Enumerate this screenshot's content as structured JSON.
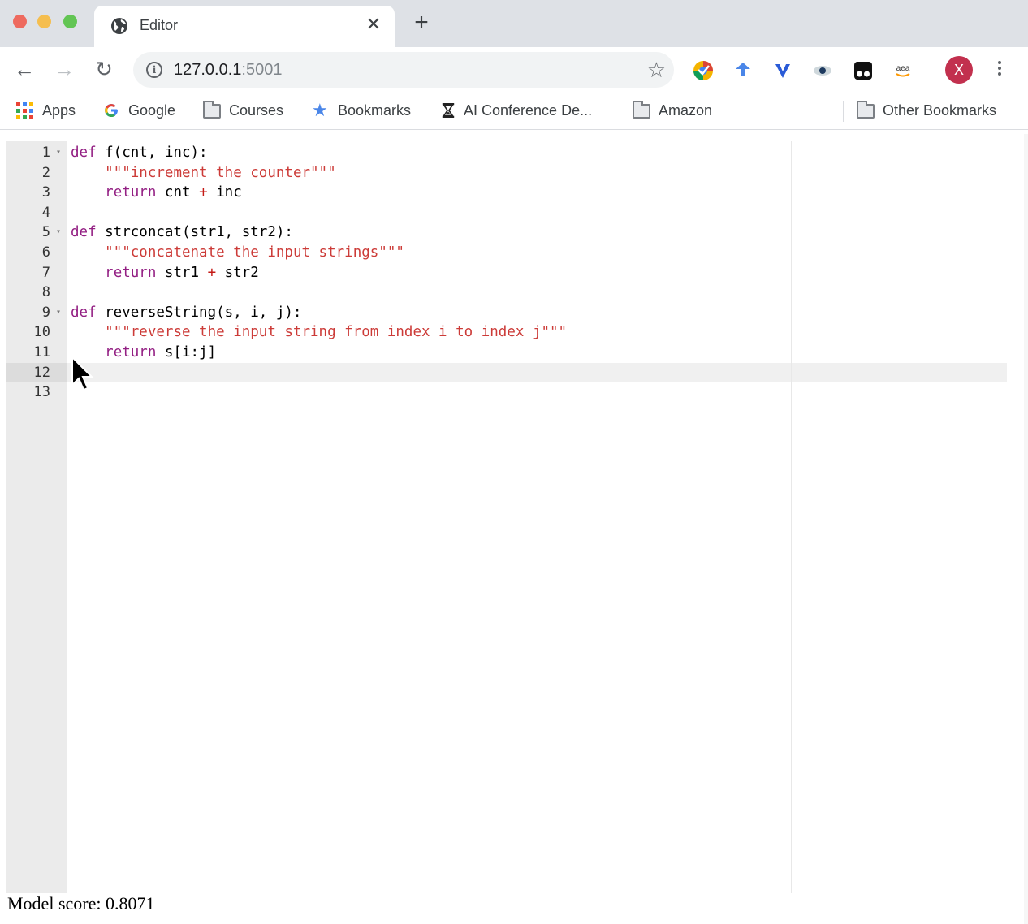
{
  "browser": {
    "tab": {
      "title": "Editor",
      "favicon": "globe-icon",
      "close_glyph": "✕"
    },
    "new_tab_glyph": "+",
    "nav": {
      "back_glyph": "←",
      "forward_glyph": "→",
      "reload_glyph": "↻"
    },
    "address": {
      "host": "127.0.0.1",
      "port": ":5001",
      "info_glyph": "i",
      "star_glyph": "☆"
    },
    "extensions": [
      "chrome-extension-color-icon",
      "extension-blue-arrow-icon",
      "extension-v-icon",
      "extension-eye-icon",
      "extension-glasses-icon",
      "extension-amazon-icon"
    ],
    "profile": {
      "initial": "X",
      "color": "#c2304e"
    },
    "bookmarks": [
      {
        "label": "Apps",
        "icon": "apps-grid-icon"
      },
      {
        "label": "Google",
        "icon": "google-icon"
      },
      {
        "label": "Courses",
        "icon": "folder-icon"
      },
      {
        "label": "Bookmarks",
        "icon": "star-icon"
      },
      {
        "label": "AI Conference De...",
        "icon": "hourglass-icon"
      },
      {
        "label": "Amazon",
        "icon": "folder-icon"
      }
    ],
    "other_bookmarks": {
      "label": "Other Bookmarks",
      "icon": "folder-icon"
    }
  },
  "editor": {
    "language": "python",
    "active_line": 12,
    "lines": [
      {
        "n": "1",
        "fold": true,
        "parts": [
          [
            "kw",
            "def"
          ],
          [
            "t",
            " f(cnt, inc):"
          ]
        ]
      },
      {
        "n": "2",
        "fold": false,
        "parts": [
          [
            "t",
            "    "
          ],
          [
            "str",
            "\"\"\"increment the counter\"\"\""
          ]
        ]
      },
      {
        "n": "3",
        "fold": false,
        "parts": [
          [
            "t",
            "    "
          ],
          [
            "ret",
            "return"
          ],
          [
            "t",
            " cnt "
          ],
          [
            "op",
            "+"
          ],
          [
            "t",
            " inc"
          ]
        ]
      },
      {
        "n": "4",
        "fold": false,
        "parts": []
      },
      {
        "n": "5",
        "fold": true,
        "parts": [
          [
            "kw",
            "def"
          ],
          [
            "t",
            " strconcat(str1, str2):"
          ]
        ]
      },
      {
        "n": "6",
        "fold": false,
        "parts": [
          [
            "t",
            "    "
          ],
          [
            "str",
            "\"\"\"concatenate the input strings\"\"\""
          ]
        ]
      },
      {
        "n": "7",
        "fold": false,
        "parts": [
          [
            "t",
            "    "
          ],
          [
            "ret",
            "return"
          ],
          [
            "t",
            " str1 "
          ],
          [
            "op",
            "+"
          ],
          [
            "t",
            " str2"
          ]
        ]
      },
      {
        "n": "8",
        "fold": false,
        "parts": []
      },
      {
        "n": "9",
        "fold": true,
        "parts": [
          [
            "kw",
            "def"
          ],
          [
            "t",
            " reverseString(s, i, j):"
          ]
        ]
      },
      {
        "n": "10",
        "fold": false,
        "parts": [
          [
            "t",
            "    "
          ],
          [
            "str",
            "\"\"\"reverse the input string from index i to index j\"\"\""
          ]
        ]
      },
      {
        "n": "11",
        "fold": false,
        "parts": [
          [
            "t",
            "    "
          ],
          [
            "ret",
            "return"
          ],
          [
            "t",
            " s[i:j]"
          ]
        ]
      },
      {
        "n": "12",
        "fold": false,
        "parts": []
      },
      {
        "n": "13",
        "fold": false,
        "parts": []
      }
    ]
  },
  "footer": {
    "score_label": "Model score: 0.8071"
  }
}
